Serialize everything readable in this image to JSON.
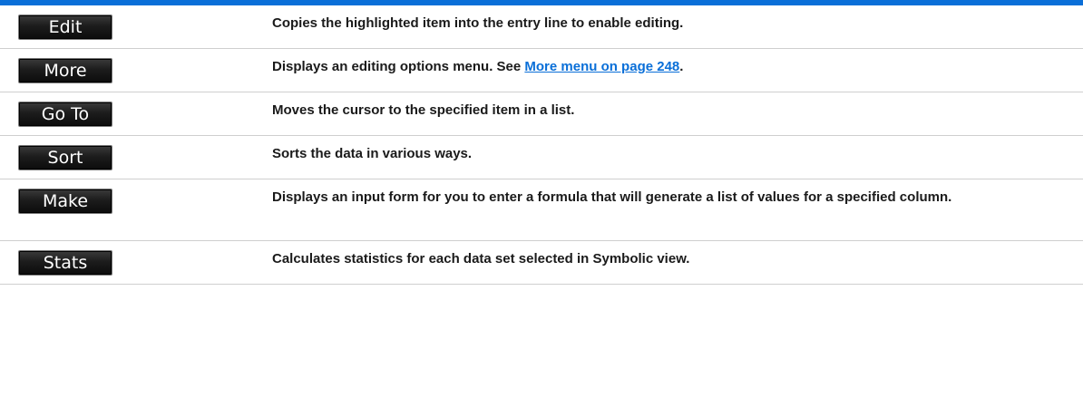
{
  "rows": [
    {
      "key": "Edit",
      "text": "Copies the highlighted item into the entry line to enable editing."
    },
    {
      "key": "More",
      "text": "Displays an editing options menu. See ",
      "link": "More menu on page 248",
      "after": "."
    },
    {
      "key": "Go To",
      "text": "Moves the cursor to the specified item in a list."
    },
    {
      "key": "Sort",
      "text": "Sorts the data in various ways."
    },
    {
      "key": "Make",
      "text": "Displays an input form for you to enter a formula that will generate a list of values for a specified column."
    },
    {
      "key": "Stats",
      "text": "Calculates statistics for each data set selected in Symbolic view."
    }
  ],
  "colors": {
    "accent": "#0a6fd8",
    "softkey_bg": "#1c1c1c",
    "rule": "#cfcfcf"
  }
}
